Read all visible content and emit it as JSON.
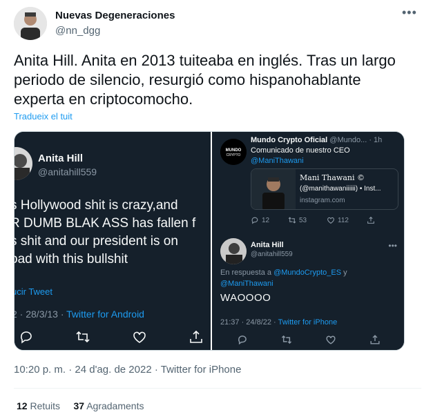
{
  "author": {
    "name": "Nuevas Degeneraciones",
    "handle": "@nn_dgg"
  },
  "tweet": {
    "text": "Anita Hill. Anita en 2013 tuiteaba en inglés. Tras un largo periodo de silencio, resurgió como hispanohablante experta en criptocomocho.",
    "translate_label": "Tradueix el tuit",
    "timestamp": "10:20 p. m. · 24 d'ag. de 2022 · Twitter for iPhone",
    "retweets_count": "12",
    "retweets_label": "Retuits",
    "likes_count": "37",
    "likes_label": "Agradaments"
  },
  "left_screenshot": {
    "name": "Anita Hill",
    "handle": "@anitahill559",
    "text": "s Hollywood shit is crazy,and\nR DUMB BLAK ASS has fallen f\ns shit and our president is on\noad with this bullshit",
    "translate_label": "ucir Tweet",
    "meta_date": "2 · 28/3/13 · ",
    "meta_source": "Twitter for Android"
  },
  "right_screenshot": {
    "top_tweet": {
      "name": "Mundo Crypto Oficial",
      "handle_time": " @Mundo... · 1h",
      "line1": "Comunicado de nuestro CEO",
      "mention": "@ManiThawani",
      "avatar_text": "MUNDO CRYPTO",
      "card_title": "Mani Thawani ©",
      "card_subtitle": "(@manithawaniiiiii) • Inst...",
      "card_domain": "instagram.com",
      "replies": "12",
      "retweets": "53",
      "likes": "112"
    },
    "reply_tweet": {
      "name": "Anita Hill",
      "handle": "@anitahill559",
      "more": "•••",
      "reply_prefix": "En respuesta a ",
      "reply_to_1": "@MundoCrypto_ES",
      "reply_and": " y",
      "reply_to_2": "@ManiThawani",
      "text": "WAOOOO",
      "meta_date": "21:37 · 24/8/22 · ",
      "meta_source": "Twitter for iPhone"
    }
  },
  "colors": {
    "link_blue": "#1d9bf0",
    "dark_bg": "#15202b",
    "secondary_text": "#536471"
  }
}
